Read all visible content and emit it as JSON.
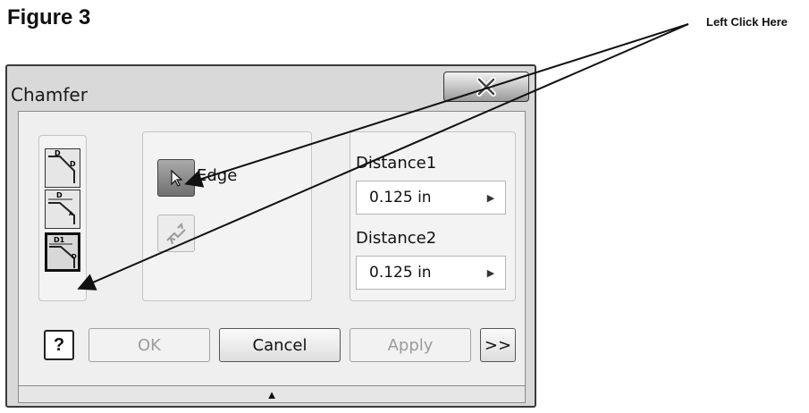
{
  "figure_title": "Figure 3",
  "callout": "Left Click Here",
  "dialog": {
    "title": "Chamfer",
    "close_glyph": "✕",
    "selection": {
      "edge_label": "Edge"
    },
    "distance1": {
      "label": "Distance1",
      "value": "0.125 in"
    },
    "distance2": {
      "label": "Distance2",
      "value": "0.125 in"
    },
    "buttons": {
      "help": "?",
      "ok": "OK",
      "cancel": "Cancel",
      "apply": "Apply",
      "more": ">>"
    },
    "expand_glyph": "▲"
  },
  "icons": {
    "close": "close-icon",
    "mode1": "chamfer-distance-icon",
    "mode2": "chamfer-distance-angle-icon",
    "mode3": "chamfer-two-distances-icon",
    "edge_select": "cursor-arrow-icon",
    "flip": "flip-direction-icon"
  },
  "colors": {
    "dialog_bg": "#d9d9d9",
    "panel_bg": "#efefef",
    "selected_tool": "#808080"
  }
}
